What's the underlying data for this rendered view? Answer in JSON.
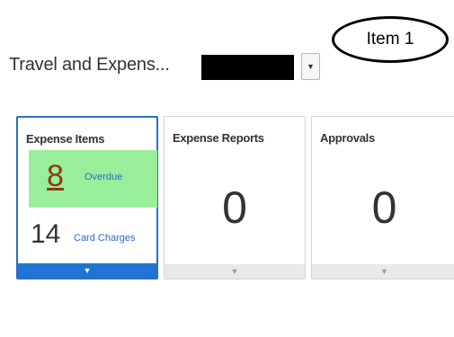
{
  "callout": {
    "label": "Item 1"
  },
  "header": {
    "title": "Travel and Expens...",
    "selector": {
      "value_redacted": true,
      "button_icon": "caret-down-icon"
    }
  },
  "tiles": [
    {
      "title": "Expense Items",
      "selected": true,
      "overdue": {
        "count": "8",
        "label": "Overdue"
      },
      "card_charges": {
        "count": "14",
        "label": "Card Charges"
      },
      "footer_icon": "caret-down-icon"
    },
    {
      "title": "Expense Reports",
      "count": "0",
      "footer_icon": "caret-down-icon"
    },
    {
      "title": "Approvals",
      "count": "0",
      "footer_icon": "caret-down-icon"
    }
  ],
  "colors": {
    "selected_border": "#2b6ec8",
    "selected_footer": "#1f74d4",
    "overdue_bg": "#99ef99",
    "overdue_count": "#8b3a14",
    "link": "#2a6ad0"
  }
}
